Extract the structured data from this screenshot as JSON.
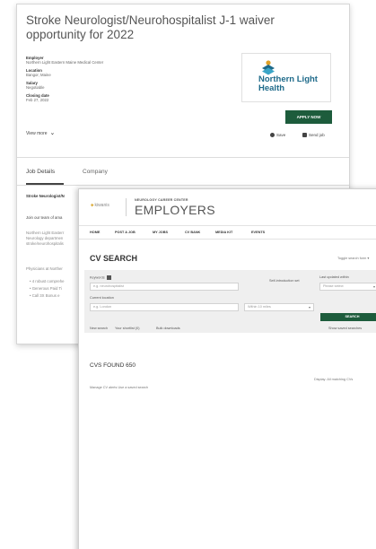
{
  "job": {
    "title": "Stroke Neurologist/Neurohospitalist J-1 waiver opportunity for 2022",
    "meta": [
      {
        "label": "Employer",
        "value": "Northern Light Eastern Maine Medical Center"
      },
      {
        "label": "Location",
        "value": "Bangor, Maine"
      },
      {
        "label": "Salary",
        "value": "Negotiable"
      },
      {
        "label": "Closing date",
        "value": "Feb 27, 2022"
      }
    ],
    "view_more": "View more",
    "logo_text": "Northern Light Health",
    "apply_label": "APPLY NOW",
    "save_label": "Save",
    "send_label": "Send job",
    "tabs": [
      "Job Details",
      "Company"
    ],
    "body": {
      "heading": "Stroke Neurologist/N",
      "p1": "Join our team of ama",
      "p2": "Northern Light Easterr Neurology departmen stroke/neurohospitalis",
      "p3": "Physicians at Norther",
      "bullets": [
        "• 4 robust comprehe",
        "• Generous Paid Ti",
        "• Call 3X Bonus e"
      ]
    }
  },
  "cv": {
    "brand": {
      "logo_text": "kiwanis",
      "network_small": "NEUROLOGY CAREER CENTER",
      "title": "EMPLOYERS"
    },
    "nav": [
      "HOME",
      "POST A JOB",
      "MY JOBS",
      "CV BANK",
      "MEDIA KIT",
      "EVENTS"
    ],
    "heading": "CV SEARCH",
    "toggle_link": "Toggle search form ▾",
    "search": {
      "keywords_label": "Keywords",
      "keywords_placeholder": "e.g. neurohospitalist",
      "location_label": "Current location",
      "location_placeholder": "e.g. London",
      "distance_value": "Within 10 miles",
      "last_updated_label": "Last updated within",
      "last_updated_value": "Please select",
      "hint_text": "Self-introduction set",
      "search_label": "SEARCH",
      "links": [
        "New search",
        "Your shortlist (0)",
        "Bulk downloads"
      ],
      "saved_link": "Show saved searches"
    },
    "results_count": "CVS FOUND 650",
    "display_info": "Display: All matching CVs",
    "manage_links": "Manage CV alerts   Use a saved search"
  }
}
